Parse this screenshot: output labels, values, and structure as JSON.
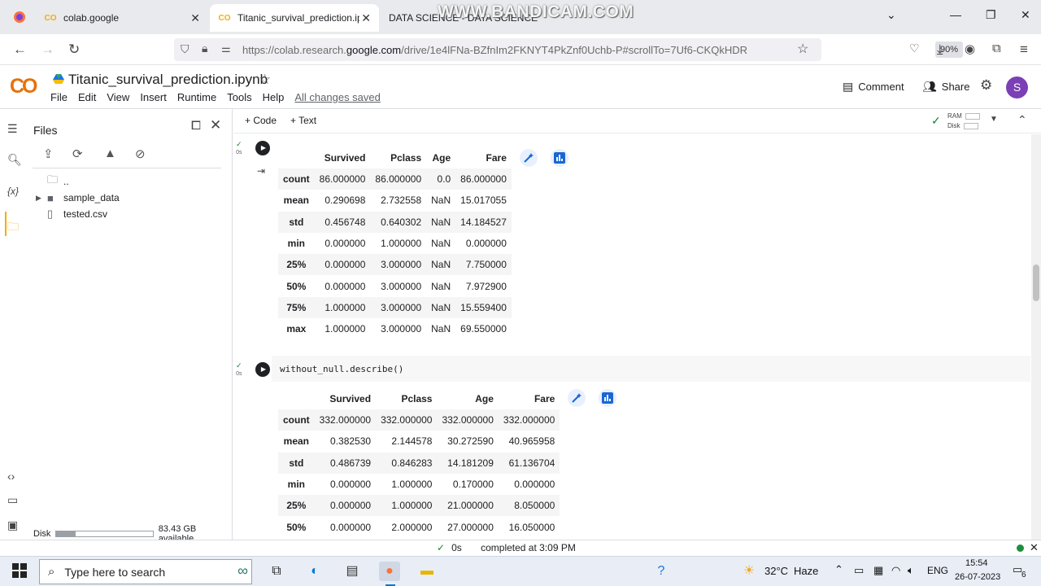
{
  "watermark": "WWW.BANDICAM.COM",
  "browser": {
    "tabs": [
      {
        "title": "colab.google"
      },
      {
        "title": "Titanic_survival_prediction.ipyn"
      },
      {
        "title": "DATA SCIENCE - DATA SCIENCE"
      }
    ],
    "url_prefix": "https://colab.research.",
    "url_domain": "google.com",
    "url_path": "/drive/1e4lFNa-BZfnIm2FKNYT4PkZnf0Uchb-P#scrollTo=7Uf6-CKQkHDR",
    "zoom": "90%"
  },
  "colab": {
    "logo": "CO",
    "title": "Titanic_survival_prediction.ipynb",
    "menu": [
      "File",
      "Edit",
      "View",
      "Insert",
      "Runtime",
      "Tools",
      "Help"
    ],
    "saved_status": "All changes saved",
    "comment_label": "Comment",
    "share_label": "Share",
    "avatar_letter": "S"
  },
  "files_panel": {
    "title": "Files",
    "tree": [
      {
        "name": ".."
      },
      {
        "name": "sample_data"
      },
      {
        "name": "tested.csv"
      }
    ],
    "disk_label": "Disk",
    "disk_available": "83.43 GB available",
    "disk_used_fraction": 0.2
  },
  "toolbar": {
    "code_label": "Code",
    "text_label": "Text",
    "ram_label": "RAM",
    "disk_label": "Disk"
  },
  "cell1": {
    "time": "0s",
    "columns": [
      "",
      "Survived",
      "Pclass",
      "Age",
      "Fare"
    ],
    "rows": [
      [
        "count",
        "86.000000",
        "86.000000",
        "0.0",
        "86.000000"
      ],
      [
        "mean",
        "0.290698",
        "2.732558",
        "NaN",
        "15.017055"
      ],
      [
        "std",
        "0.456748",
        "0.640302",
        "NaN",
        "14.184527"
      ],
      [
        "min",
        "0.000000",
        "1.000000",
        "NaN",
        "0.000000"
      ],
      [
        "25%",
        "0.000000",
        "3.000000",
        "NaN",
        "7.750000"
      ],
      [
        "50%",
        "0.000000",
        "3.000000",
        "NaN",
        "7.972900"
      ],
      [
        "75%",
        "1.000000",
        "3.000000",
        "NaN",
        "15.559400"
      ],
      [
        "max",
        "1.000000",
        "3.000000",
        "NaN",
        "69.550000"
      ]
    ]
  },
  "cell2": {
    "time": "0s",
    "code": "without_null.describe()",
    "columns": [
      "",
      "Survived",
      "Pclass",
      "Age",
      "Fare"
    ],
    "rows": [
      [
        "count",
        "332.000000",
        "332.000000",
        "332.000000",
        "332.000000"
      ],
      [
        "mean",
        "0.382530",
        "2.144578",
        "30.272590",
        "40.965958"
      ],
      [
        "std",
        "0.486739",
        "0.846283",
        "14.181209",
        "61.136704"
      ],
      [
        "min",
        "0.000000",
        "1.000000",
        "0.170000",
        "0.000000"
      ],
      [
        "25%",
        "0.000000",
        "1.000000",
        "21.000000",
        "8.050000"
      ],
      [
        "50%",
        "0.000000",
        "2.000000",
        "27.000000",
        "16.050000"
      ]
    ]
  },
  "statusbar": {
    "time": "0s",
    "completed": "completed at 3:09 PM"
  },
  "taskbar": {
    "search_placeholder": "Type here to search",
    "weather_temp": "32°C",
    "weather_desc": "Haze",
    "lang": "ENG",
    "time": "15:54",
    "date": "26-07-2023",
    "notif_count": "6"
  }
}
